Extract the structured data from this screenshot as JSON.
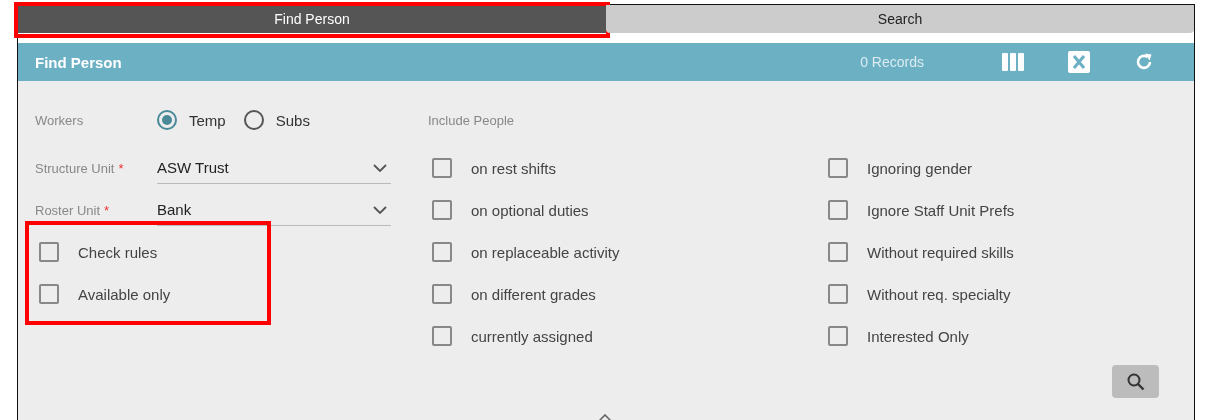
{
  "tabs": [
    {
      "label": "Find Person",
      "selected": true,
      "highlighted": true
    },
    {
      "label": "Search",
      "selected": false,
      "highlighted": false
    }
  ],
  "header": {
    "title": "Find Person",
    "records": "0 Records"
  },
  "workers": {
    "label": "Workers",
    "options": [
      {
        "label": "Temp",
        "selected": true
      },
      {
        "label": "Subs",
        "selected": false
      }
    ]
  },
  "dropdowns": [
    {
      "label": "Structure Unit",
      "required_mark": "*",
      "value": "ASW Trust"
    },
    {
      "label": "Roster Unit",
      "required_mark": "*",
      "value": "Bank"
    }
  ],
  "options": {
    "highlighted": true,
    "items": [
      {
        "label": "Check rules",
        "checked": false
      },
      {
        "label": "Available only",
        "checked": false
      }
    ]
  },
  "include_people": {
    "label": "Include People",
    "columns": [
      [
        {
          "label": "on rest shifts",
          "checked": false
        },
        {
          "label": "on optional duties",
          "checked": false
        },
        {
          "label": "on replaceable activity",
          "checked": false
        },
        {
          "label": "on different grades",
          "checked": false
        },
        {
          "label": "currently assigned",
          "checked": false
        }
      ],
      [
        {
          "label": "Ignoring gender",
          "checked": false
        },
        {
          "label": "Ignore Staff Unit Prefs",
          "checked": false
        },
        {
          "label": "Without required skills",
          "checked": false
        },
        {
          "label": "Without req. specialty",
          "checked": false
        },
        {
          "label": "Interested Only",
          "checked": false
        }
      ]
    ]
  }
}
